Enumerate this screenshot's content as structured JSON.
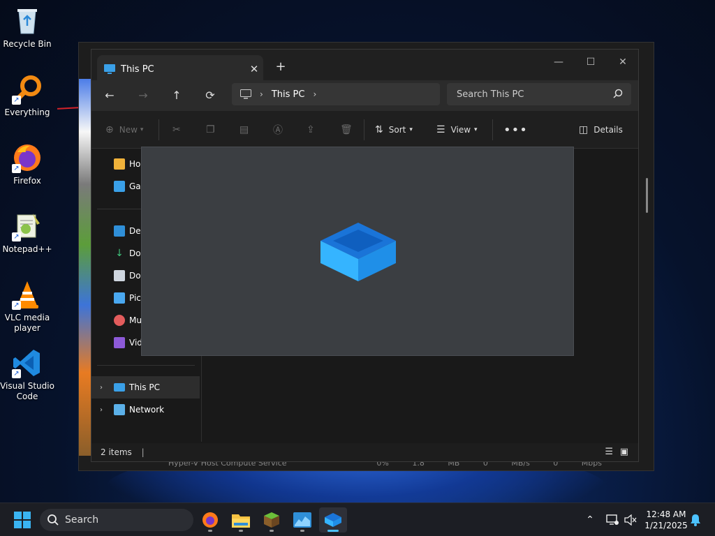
{
  "desktop": {
    "icons": [
      {
        "label": "Recycle Bin"
      },
      {
        "label": "Everything"
      },
      {
        "label": "Firefox"
      },
      {
        "label": "Notepad++"
      },
      {
        "label": "VLC media player"
      },
      {
        "label": "Visual Studio Code"
      }
    ]
  },
  "background_window": {
    "row_name": "Hyper-V Host Compute Service",
    "row_values": "0% 1.8 MB 0 MB/s 0 Mbps"
  },
  "explorer": {
    "tab_title": "This PC",
    "address": {
      "location": "This PC"
    },
    "search_placeholder": "Search This PC",
    "commands": {
      "new": "New",
      "sort": "Sort",
      "view": "View",
      "details": "Details"
    },
    "sidebar": {
      "items": [
        {
          "label": "Ho"
        },
        {
          "label": "Gal"
        },
        {
          "label": "Des"
        },
        {
          "label": "Dov"
        },
        {
          "label": "Doc"
        },
        {
          "label": "Pic"
        },
        {
          "label": "Mu"
        },
        {
          "label": "Vid"
        },
        {
          "label": "This PC"
        },
        {
          "label": "Network"
        }
      ]
    },
    "status": {
      "items_count": "2 items"
    }
  },
  "taskbar": {
    "search_label": "Search",
    "time": "12:48 AM",
    "date": "1/21/2025"
  },
  "colors": {
    "accent": "#4cc2ff",
    "window_bg": "#191919",
    "splash_bg": "#3b3e42"
  }
}
